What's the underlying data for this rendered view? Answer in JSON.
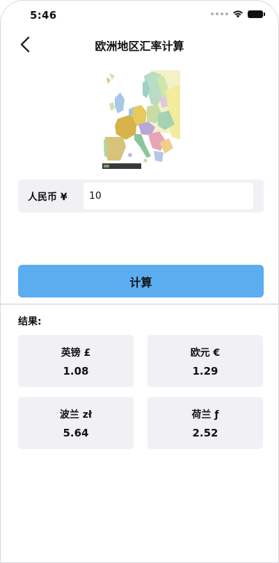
{
  "status_bar": {
    "time": "5:46"
  },
  "nav": {
    "title": "欧洲地区汇率计算",
    "back_icon": "chevron-left-icon"
  },
  "map": {
    "caption": "Europe map"
  },
  "input": {
    "label": "人民币 ¥",
    "value": "10",
    "placeholder": ""
  },
  "calculate_button": {
    "label": "计算",
    "color": "#5badf0"
  },
  "results": {
    "title": "结果:",
    "cards": [
      {
        "name": "英镑 £",
        "value": "1.08"
      },
      {
        "name": "欧元 €",
        "value": "1.29"
      },
      {
        "name": "波兰 zł",
        "value": "5.64"
      },
      {
        "name": "荷兰 ƒ",
        "value": "2.52"
      }
    ]
  }
}
